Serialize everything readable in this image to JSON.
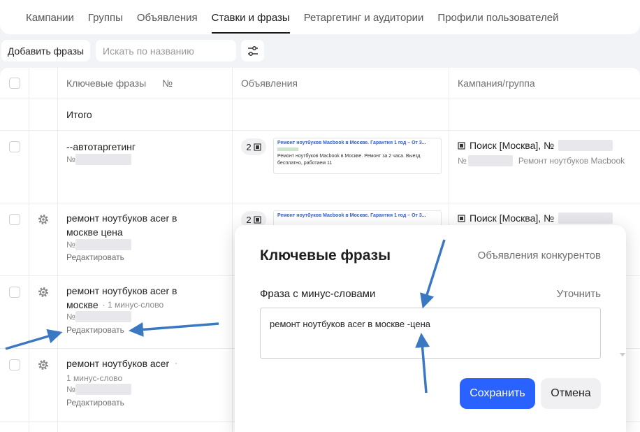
{
  "tabs": [
    {
      "label": "Кампании"
    },
    {
      "label": "Группы"
    },
    {
      "label": "Объявления"
    },
    {
      "label": "Ставки и фразы",
      "active": true
    },
    {
      "label": "Ретаргетинг и аудитории"
    },
    {
      "label": "Профили пользователей"
    }
  ],
  "toolbar": {
    "add_label": "Добавить фразы",
    "search_placeholder": "Искать по названию"
  },
  "table": {
    "headers": {
      "phrases": "Ключевые фразы",
      "number": "№",
      "ads": "Объявления",
      "campaign": "Кампания/группа"
    },
    "total_label": "Итого",
    "rows": [
      {
        "phrase": "--автотаргетинг",
        "number_prefix": "№",
        "ad_count": "2",
        "ad_title": "Ремонт ноутбуков Macbook в Москве. Гарантия 1 год – От 3...",
        "ad_desc": "Ремонт ноутбуков Macbook в Москве. Ремонт за 2 часа. Выезд бесплатно, работаем 11",
        "campaign": "Поиск [Москва], №",
        "group_prefix": "№",
        "group_name": "Ремонт ноутбуков Macbook"
      },
      {
        "phrase": "ремонт ноутбуков acer в москве цена",
        "number_prefix": "№",
        "edit": "Редактировать",
        "ad_count": "2",
        "ad_title": "Ремонт ноутбуков Macbook в Москве. Гарантия 1 год – От 3...",
        "campaign": "Поиск [Москва], №"
      },
      {
        "phrase_line1": "ремонт ноутбуков acer в",
        "phrase_line2": "москве",
        "minus": "· 1 минус-слово",
        "number_prefix": "№",
        "edit": "Редактировать"
      },
      {
        "phrase": "ремонт ноутбуков acer",
        "dot": "·",
        "minus": "1 минус-слово",
        "number_prefix": "№",
        "edit": "Редактировать"
      }
    ]
  },
  "popup": {
    "title": "Ключевые фразы",
    "competitors_link": "Объявления конкурентов",
    "field_label": "Фраза с минус-словами",
    "refine_link": "Уточнить",
    "textarea_value": "ремонт ноутбуков acer в москве -цена",
    "save_label": "Сохранить",
    "cancel_label": "Отмена"
  },
  "colors": {
    "primary": "#2962ff",
    "arrow": "#3a78c2"
  },
  "icons": [
    "filter-icon",
    "gear-icon",
    "ad-image-icon",
    "campaign-icon",
    "scroll-down-icon"
  ]
}
